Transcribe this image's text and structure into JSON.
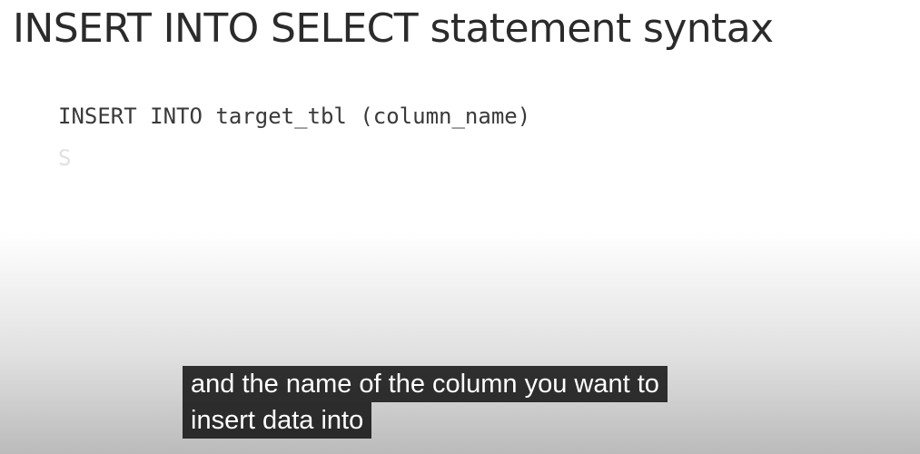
{
  "slide": {
    "title": "INSERT INTO SELECT statement syntax",
    "code_line_1": "INSERT INTO target_tbl (column_name)",
    "code_line_2_partial": "S"
  },
  "captions": {
    "line_1": "and the name of the column you want to",
    "line_2": "insert data into"
  }
}
